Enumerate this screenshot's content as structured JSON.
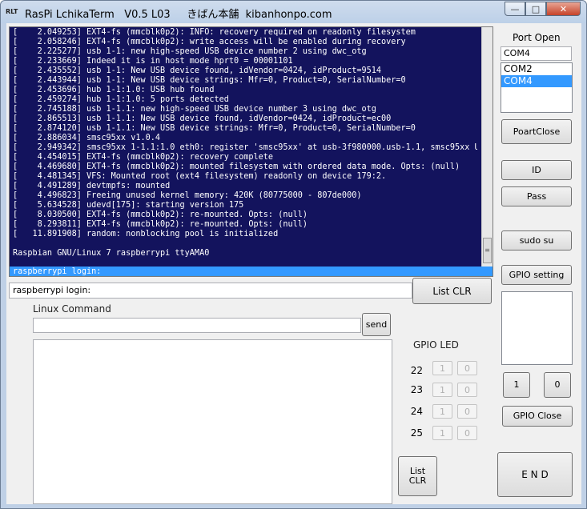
{
  "window": {
    "icon": "RLT",
    "title": "RasPi LchikaTerm   V0.5 L03     きばん本舗  kibanhonpo.com",
    "minimize": "—",
    "maximize": "□",
    "close": "✕"
  },
  "terminal": {
    "lines": [
      "[    2.049253] EXT4-fs (mmcblk0p2): INFO: recovery required on readonly filesystem",
      "[    2.058246] EXT4-fs (mmcblk0p2): write access will be enabled during recovery",
      "[    2.225277] usb 1-1: new high-speed USB device number 2 using dwc_otg",
      "[    2.233669] Indeed it is in host mode hprt0 = 00001101",
      "[    2.435552] usb 1-1: New USB device found, idVendor=0424, idProduct=9514",
      "[    2.443944] usb 1-1: New USB device strings: Mfr=0, Product=0, SerialNumber=0",
      "[    2.453696] hub 1-1:1.0: USB hub found",
      "[    2.459274] hub 1-1:1.0: 5 ports detected",
      "[    2.745188] usb 1-1.1: new high-speed USB device number 3 using dwc_otg",
      "[    2.865513] usb 1-1.1: New USB device found, idVendor=0424, idProduct=ec00",
      "[    2.874120] usb 1-1.1: New USB device strings: Mfr=0, Product=0, SerialNumber=0",
      "[    2.886034] smsc95xx v1.0.4",
      "[    2.949342] smsc95xx 1-1.1:1.0 eth0: register 'smsc95xx' at usb-3f980000.usb-1.1, smsc95xx USB",
      "[    4.454015] EXT4-fs (mmcblk0p2): recovery complete",
      "[    4.469680] EXT4-fs (mmcblk0p2): mounted filesystem with ordered data mode. Opts: (null)",
      "[    4.481345] VFS: Mounted root (ext4 filesystem) readonly on device 179:2.",
      "[    4.491289] devtmpfs: mounted",
      "[    4.496823] Freeing unused kernel memory: 420K (80775000 - 807de000)",
      "[    5.634528] udevd[175]: starting version 175",
      "[    8.030500] EXT4-fs (mmcblk0p2): re-mounted. Opts: (null)",
      "[    8.293811] EXT4-fs (mmcblk0p2): re-mounted. Opts: (null)",
      "[   11.891908] random: nonblocking pool is initialized",
      "",
      "Raspbian GNU/Linux 7 raspberrypi ttyAMA0"
    ],
    "selected_line": "raspberrypi login:",
    "scroll_grip": "≡"
  },
  "login_field": {
    "value": "raspberrypi login:"
  },
  "buttons": {
    "list_clr_top": "List CLR",
    "send": "send",
    "list_clr_bottom_1": "List",
    "list_clr_bottom_2": "CLR",
    "port_close": "PoartClose",
    "id": "ID",
    "pass": "Pass",
    "sudo_su": "sudo su",
    "gpio_setting": "GPIO setting",
    "one": "1",
    "zero": "0",
    "gpio_close": "GPIO Close",
    "end": "E N D"
  },
  "linux_command": {
    "label": "Linux Command",
    "value": ""
  },
  "gpio_led": {
    "label": "GPIO LED",
    "rows": [
      {
        "pin": "22",
        "on": "1",
        "off": "0"
      },
      {
        "pin": "23",
        "on": "1",
        "off": "0"
      },
      {
        "pin": "24",
        "on": "1",
        "off": "0"
      },
      {
        "pin": "25",
        "on": "1",
        "off": "0"
      }
    ]
  },
  "port": {
    "label": "Port Open",
    "value": "COM4",
    "options": [
      "COM2",
      "COM4"
    ],
    "selected": "COM4"
  },
  "colors": {
    "terminal_bg": "#13135d",
    "selection": "#3399ff",
    "titlebar": "#bfd0e6"
  }
}
